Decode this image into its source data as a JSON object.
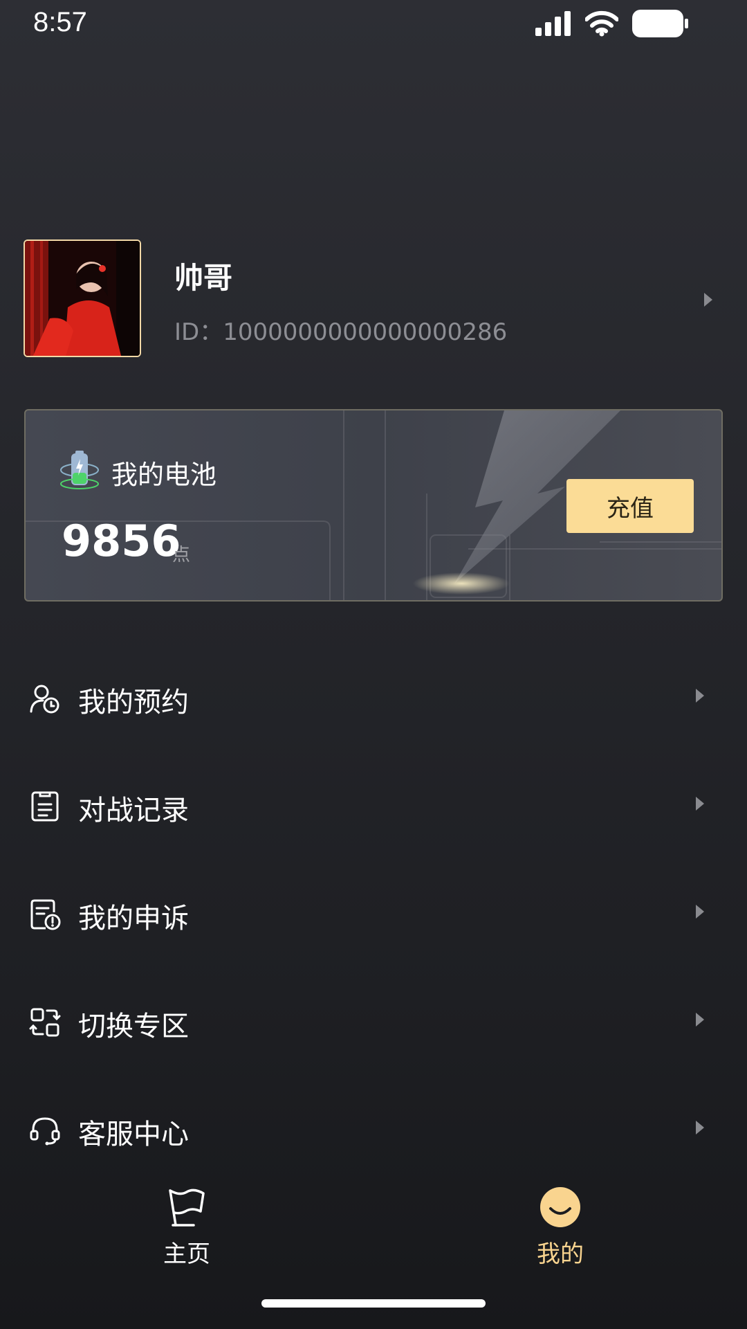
{
  "status_bar": {
    "time": "8:57"
  },
  "profile": {
    "nickname": "帅哥",
    "user_id": "ID：1000000000000000286"
  },
  "battery": {
    "title": "我的电池",
    "value": "9856",
    "unit": "点",
    "recharge_label": "充值"
  },
  "menu": {
    "items": [
      {
        "label": "我的预约",
        "icon": "user-clock-icon"
      },
      {
        "label": "对战记录",
        "icon": "document-list-icon"
      },
      {
        "label": "我的申诉",
        "icon": "document-alert-icon"
      },
      {
        "label": "切换专区",
        "icon": "switch-zone-icon"
      },
      {
        "label": "客服中心",
        "icon": "headset-icon"
      }
    ]
  },
  "tabs": {
    "home": {
      "label": "主页",
      "icon": "flag-icon"
    },
    "mine": {
      "label": "我的",
      "icon": "smile-icon"
    }
  },
  "colors": {
    "accent": "#fbdc96",
    "active_tab": "#f9d48f",
    "text_secondary": "#8d8e94"
  }
}
